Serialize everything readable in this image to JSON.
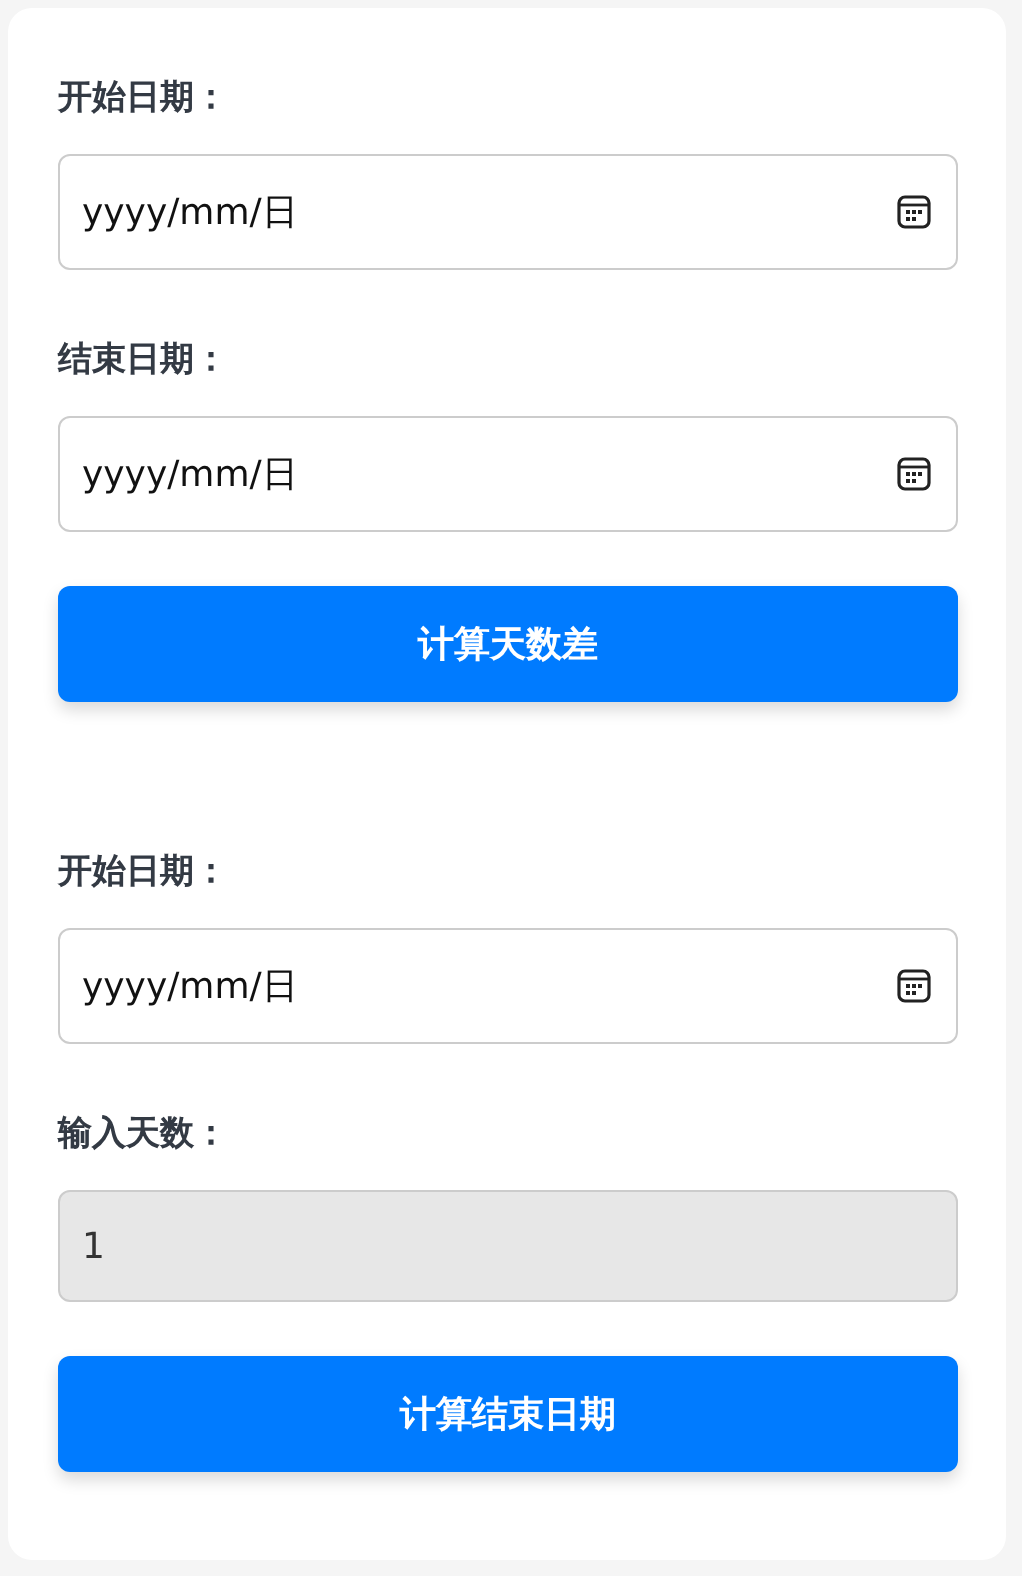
{
  "sections": [
    {
      "fields": [
        {
          "label": "开始日期：",
          "kind": "date",
          "placeholder": "yyyy/mm/日",
          "disabled": false
        },
        {
          "label": "结束日期：",
          "kind": "date",
          "placeholder": "yyyy/mm/日",
          "disabled": false
        }
      ],
      "button": "计算天数差"
    },
    {
      "fields": [
        {
          "label": "开始日期：",
          "kind": "date",
          "placeholder": "yyyy/mm/日",
          "disabled": false
        },
        {
          "label": "输入天数：",
          "kind": "number",
          "value": "1",
          "disabled": true
        }
      ],
      "button": "计算结束日期"
    }
  ]
}
